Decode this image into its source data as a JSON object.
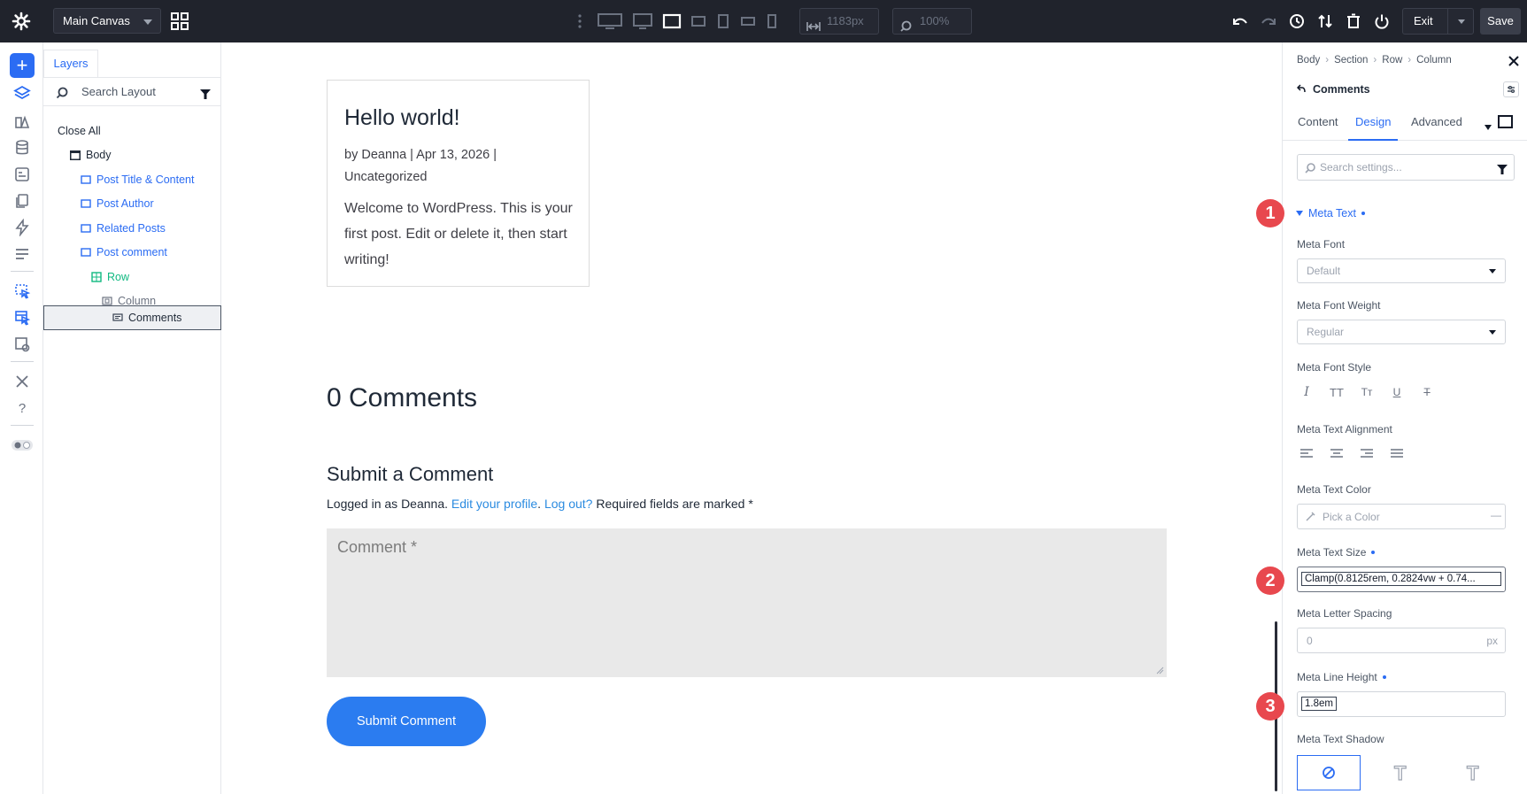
{
  "topbar": {
    "canvas_select": "Main Canvas",
    "width_value": "1183px",
    "zoom_value": "100%",
    "exit_label": "Exit",
    "save_label": "Save"
  },
  "layers": {
    "tab_label": "Layers",
    "search_placeholder": "Search Layout",
    "close_all": "Close All",
    "items": [
      {
        "label": "Body"
      },
      {
        "label": "Post Title & Content"
      },
      {
        "label": "Post Author"
      },
      {
        "label": "Related Posts"
      },
      {
        "label": "Post comment"
      },
      {
        "label": "Row"
      },
      {
        "label": "Column"
      },
      {
        "label": "Comments"
      }
    ]
  },
  "preview": {
    "post_title": "Hello world!",
    "post_meta": "by Deanna | Apr 13, 2026 | Uncategorized",
    "post_body": "Welcome to WordPress. This is your first post. Edit or delete it, then start writing!",
    "comments_count": "0 Comments",
    "reply_title": "Submit a Comment",
    "logged_in_prefix": "Logged in as Deanna.",
    "edit_profile": "Edit your profile",
    "logout": "Log out?",
    "required_note": "Required fields are marked *",
    "comment_placeholder": "Comment *",
    "submit_label": "Submit Comment"
  },
  "settings": {
    "breadcrumb": [
      "Body",
      "Section",
      "Row",
      "Column"
    ],
    "module_name": "Comments",
    "tabs": [
      "Content",
      "Design",
      "Advanced"
    ],
    "active_tab": "Design",
    "search_placeholder": "Search settings...",
    "group_title": "Meta Text",
    "fields": {
      "meta_font_label": "Meta Font",
      "meta_font_value": "Default",
      "meta_font_weight_label": "Meta Font Weight",
      "meta_font_weight_value": "Regular",
      "meta_font_style_label": "Meta Font Style",
      "meta_text_alignment_label": "Meta Text Alignment",
      "meta_text_color_label": "Meta Text Color",
      "meta_text_color_placeholder": "Pick a Color",
      "meta_text_size_label": "Meta Text Size",
      "meta_text_size_value": "Clamp(0.8125rem, 0.2824vw + 0.74...",
      "meta_letter_spacing_label": "Meta Letter Spacing",
      "meta_letter_spacing_placeholder": "0",
      "meta_letter_spacing_unit": "px",
      "meta_line_height_label": "Meta Line Height",
      "meta_line_height_value": "1.8em",
      "meta_text_shadow_label": "Meta Text Shadow"
    }
  },
  "callouts": [
    "1",
    "2",
    "3"
  ],
  "colors": {
    "accent": "#2b6cf3",
    "topbar_bg": "#20232c",
    "callout_red": "#e8484e",
    "submit_blue": "#2b7cf0",
    "row_green": "#10b981"
  }
}
